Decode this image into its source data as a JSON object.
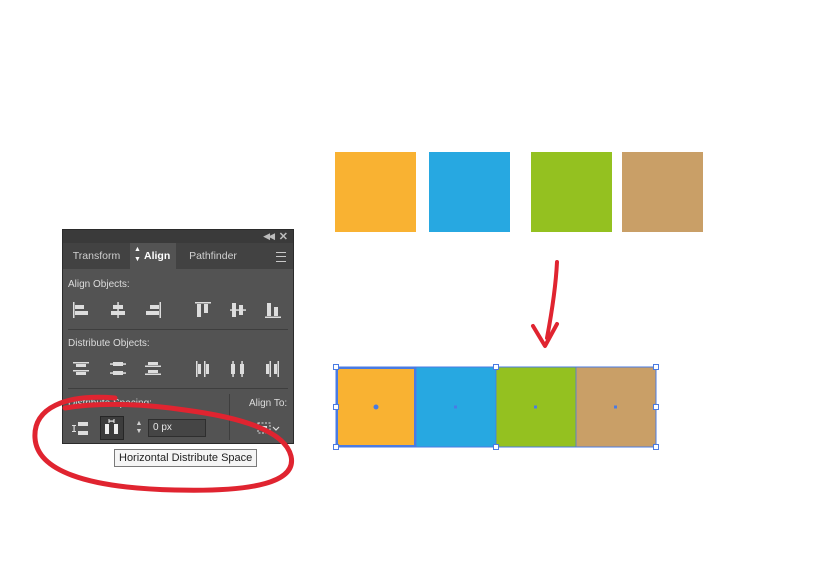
{
  "colors": {
    "orange": "#F9B232",
    "blue": "#27A8E1",
    "green": "#94C120",
    "tan": "#C99F67",
    "selection": "#4A7BE3",
    "annotation": "#E02430",
    "panel_bg": "#535353"
  },
  "panel": {
    "tabs": [
      {
        "label": "Transform"
      },
      {
        "label": "Align",
        "active": true
      },
      {
        "label": "Pathfinder"
      }
    ],
    "align_objects_label": "Align Objects:",
    "distribute_objects_label": "Distribute Objects:",
    "distribute_spacing_label": "Distribute Spacing:",
    "align_to_label": "Align To:",
    "spacing_value": "0 px"
  },
  "tooltip": {
    "text": "Horizontal Distribute Space"
  },
  "icons": {
    "panel": [
      "collapse-icon",
      "close-icon",
      "panel-menu-icon",
      "stepper-icon"
    ],
    "align_objects": [
      "horizontal-align-left-icon",
      "horizontal-align-center-icon",
      "horizontal-align-right-icon",
      "vertical-align-top-icon",
      "vertical-align-center-icon",
      "vertical-align-bottom-icon"
    ],
    "distribute_objects": [
      "vertical-distribute-top-icon",
      "vertical-distribute-center-icon",
      "vertical-distribute-bottom-icon",
      "horizontal-distribute-left-icon",
      "horizontal-distribute-center-icon",
      "horizontal-distribute-right-icon"
    ],
    "distribute_spacing": [
      "vertical-distribute-space-icon",
      "horizontal-distribute-space-icon"
    ],
    "align_to": [
      "align-to-selection-icon"
    ]
  }
}
